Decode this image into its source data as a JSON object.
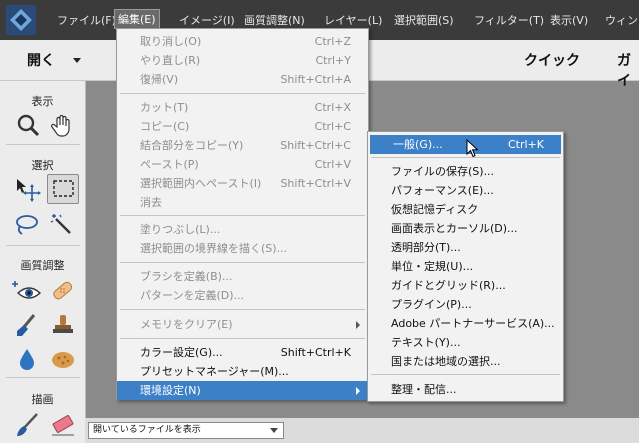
{
  "menubar": {
    "items": [
      {
        "label": "ファイル(F)"
      },
      {
        "label": "編集(E)"
      },
      {
        "label": "イメージ(I)"
      },
      {
        "label": "画質調整(N)"
      },
      {
        "label": "レイヤー(L)"
      },
      {
        "label": "選択範囲(S)"
      },
      {
        "label": "フィルター(T)"
      },
      {
        "label": "表示(V)"
      },
      {
        "label": "ウィンド"
      }
    ]
  },
  "toolbar": {
    "open_label": "開く",
    "quick_label": "クイック",
    "guided_label": "ガイ"
  },
  "tools": {
    "view_label": "表示",
    "select_label": "選択",
    "enhance_label": "画質調整",
    "draw_label": "描画"
  },
  "bottombar": {
    "file_select_value": "開いているファイルを表示"
  },
  "edit_menu": {
    "items": [
      {
        "label": "取り消し(O)",
        "shortcut": "Ctrl+Z"
      },
      {
        "label": "やり直し(R)",
        "shortcut": "Ctrl+Y"
      },
      {
        "label": "復帰(V)",
        "shortcut": "Shift+Ctrl+A"
      },
      {
        "label": "カット(T)",
        "shortcut": "Ctrl+X"
      },
      {
        "label": "コピー(C)",
        "shortcut": "Ctrl+C"
      },
      {
        "label": "結合部分をコピー(Y)",
        "shortcut": "Shift+Ctrl+C"
      },
      {
        "label": "ペースト(P)",
        "shortcut": "Ctrl+V"
      },
      {
        "label": "選択範囲内へペースト(I)",
        "shortcut": "Shift+Ctrl+V"
      },
      {
        "label": "消去",
        "shortcut": ""
      },
      {
        "label": "塗りつぶし(L)...",
        "shortcut": ""
      },
      {
        "label": "選択範囲の境界線を描く(S)...",
        "shortcut": ""
      },
      {
        "label": "ブラシを定義(B)...",
        "shortcut": ""
      },
      {
        "label": "パターンを定義(D)...",
        "shortcut": ""
      },
      {
        "label": "メモリをクリア(E)",
        "shortcut": ""
      },
      {
        "label": "カラー設定(G)...",
        "shortcut": "Shift+Ctrl+K"
      },
      {
        "label": "プリセットマネージャー(M)...",
        "shortcut": ""
      },
      {
        "label": "環境設定(N)",
        "shortcut": ""
      }
    ]
  },
  "prefs_menu": {
    "items": [
      {
        "label": "一般(G)...",
        "shortcut": "Ctrl+K"
      },
      {
        "label": "ファイルの保存(S)..."
      },
      {
        "label": "パフォーマンス(E)..."
      },
      {
        "label": "仮想記憶ディスク"
      },
      {
        "label": "画面表示とカーソル(D)..."
      },
      {
        "label": "透明部分(T)..."
      },
      {
        "label": "単位・定規(U)..."
      },
      {
        "label": "ガイドとグリッド(R)..."
      },
      {
        "label": "プラグイン(P)..."
      },
      {
        "label": "Adobe パートナーサービス(A)..."
      },
      {
        "label": "テキスト(Y)..."
      },
      {
        "label": "国または地域の選択..."
      },
      {
        "label": "整理・配信..."
      }
    ]
  },
  "colors": {
    "menubar_bg": "#3b3b3b",
    "highlight": "#3c81c8",
    "canvas_bg": "#8a8a8a"
  }
}
